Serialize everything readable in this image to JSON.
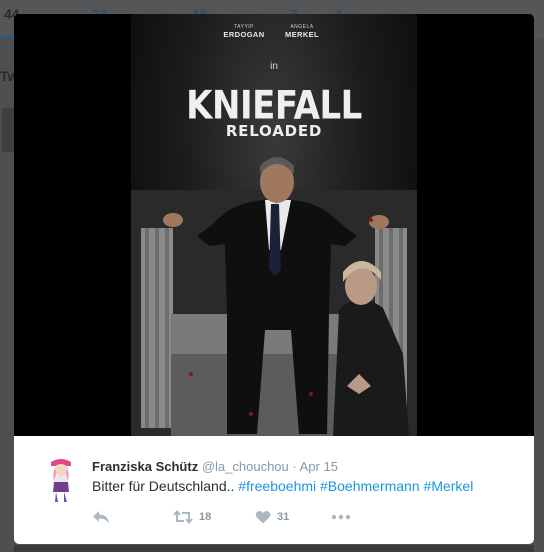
{
  "background": {
    "tab_counts": [
      "44",
      "23",
      "18",
      "7",
      "3"
    ],
    "side_text": "Tw"
  },
  "poster": {
    "name_left_first": "TAYYIP",
    "name_left_last": "ERDOGAN",
    "name_right_first": "ANGELA",
    "name_right_last": "MERKEL",
    "in_text": "in",
    "title": "KNIEFALL",
    "subtitle": "RELOADED"
  },
  "tweet": {
    "display_name": "Franziska Schütz",
    "handle": "@la_chouchou",
    "separator": "·",
    "date": "Apr 15",
    "text_prefix": "Bitter für Deutschland.. ",
    "hashtags": [
      "#freeboehmi",
      "#Boehmermann",
      "#Merkel"
    ],
    "retweet_count": "18",
    "like_count": "31"
  },
  "colors": {
    "link": "#1b95e0",
    "action_gray": "#aab8c2",
    "text": "#292f33",
    "muted": "#8899a6"
  },
  "icons": [
    "reply-icon",
    "retweet-icon",
    "heart-icon",
    "more-icon"
  ]
}
